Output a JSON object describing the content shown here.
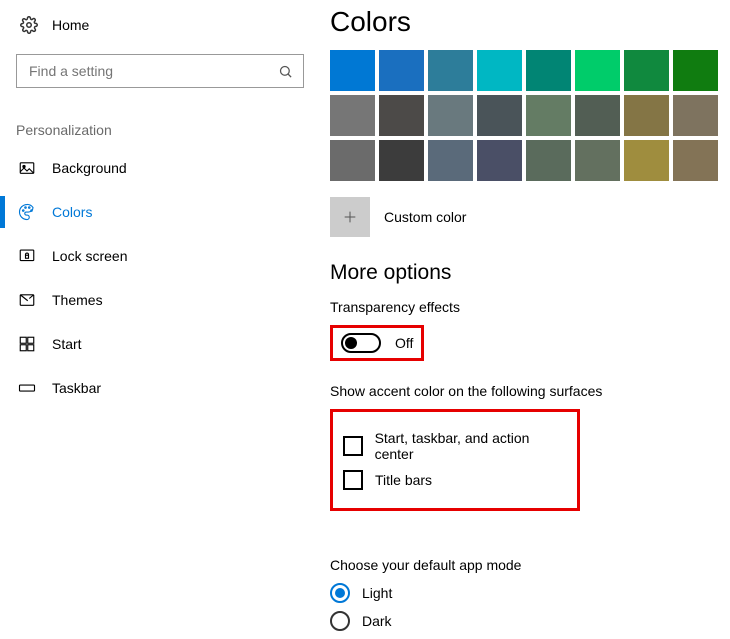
{
  "header": {
    "home": "Home",
    "search_placeholder": "Find a setting"
  },
  "section": "Personalization",
  "nav": [
    {
      "key": "background",
      "label": "Background"
    },
    {
      "key": "colors",
      "label": "Colors",
      "active": true
    },
    {
      "key": "lockscreen",
      "label": "Lock screen"
    },
    {
      "key": "themes",
      "label": "Themes"
    },
    {
      "key": "start",
      "label": "Start"
    },
    {
      "key": "taskbar",
      "label": "Taskbar"
    }
  ],
  "pageTitle": "Colors",
  "swatches": [
    "#0078d4",
    "#1a6fbf",
    "#2d7d9a",
    "#00b7c3",
    "#018574",
    "#00cc6a",
    "#10893e",
    "#107c10",
    "#767676",
    "#4c4a48",
    "#69797e",
    "#4a5459",
    "#647c64",
    "#525e54",
    "#847545",
    "#7e735f",
    "#6b6b6b",
    "#3c3c3c",
    "#5a6a7a",
    "#4a4f66",
    "#5a6b5c",
    "#63705f",
    "#9f8d3e",
    "#837356"
  ],
  "customColor": "Custom color",
  "more": {
    "heading": "More options",
    "transparency": {
      "label": "Transparency effects",
      "state": "Off"
    },
    "accent": {
      "label": "Show accent color on the following surfaces",
      "options": [
        "Start, taskbar, and action center",
        "Title bars"
      ]
    },
    "appMode": {
      "label": "Choose your default app mode",
      "options": [
        "Light",
        "Dark"
      ],
      "selected": "Light"
    }
  }
}
